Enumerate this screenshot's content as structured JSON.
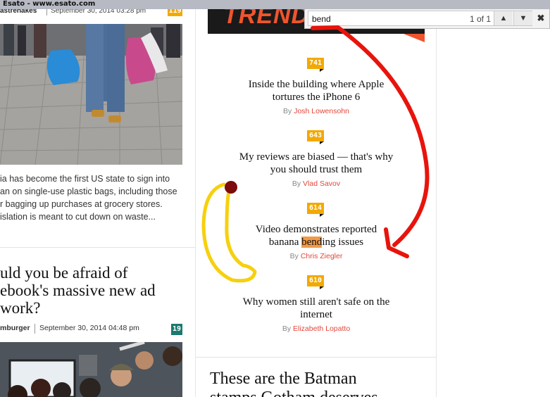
{
  "window": {
    "title": "Esato - www.esato.com"
  },
  "left_article_1": {
    "author": "astrenakes",
    "date": "September 30, 2014 03:28 pm",
    "comment_count": "119",
    "excerpt": "ia has become the first US state to sign into\nan on single-use plastic bags, including those\nr bagging up purchases at grocery stores.\nislation is meant to cut down on waste..."
  },
  "left_article_2": {
    "headline": "uld you be afraid of\nebook's massive new ad\nwork?",
    "author": "mburger",
    "date": "September 30, 2014 04:48 pm",
    "comment_count": "19"
  },
  "trending": {
    "banner": "TRENDING",
    "by_prefix": "By",
    "items": [
      {
        "count": "741",
        "title": "Inside the building where Apple\ntortures the iPhone 6",
        "author": "Josh Lowensohn"
      },
      {
        "count": "643",
        "title": "My reviews are biased — that's why\nyou should trust them",
        "author": "Vlad Savov"
      },
      {
        "count": "614",
        "title_line1": "Video demonstrates reported",
        "title_pre": "banana ",
        "title_hl": "bend",
        "title_post": "ing issues",
        "author": "Chris Ziegler"
      },
      {
        "count": "610",
        "title": "Why women still aren't safe on the\ninternet",
        "author": "Elizabeth Lopatto"
      }
    ]
  },
  "bottom_headline": "These are the Batman\nstamps Gotham deserves",
  "find_bar": {
    "query": "bend",
    "match_count": "1 of 1",
    "prev_icon": "▲",
    "next_icon": "▼",
    "close_icon": "✖"
  },
  "colors": {
    "accent_orange": "#f2a900",
    "author_red": "#e2473b",
    "highlight": "#f29a47",
    "annotation_red": "#e8140c",
    "annotation_yellow": "#f7d00e"
  }
}
